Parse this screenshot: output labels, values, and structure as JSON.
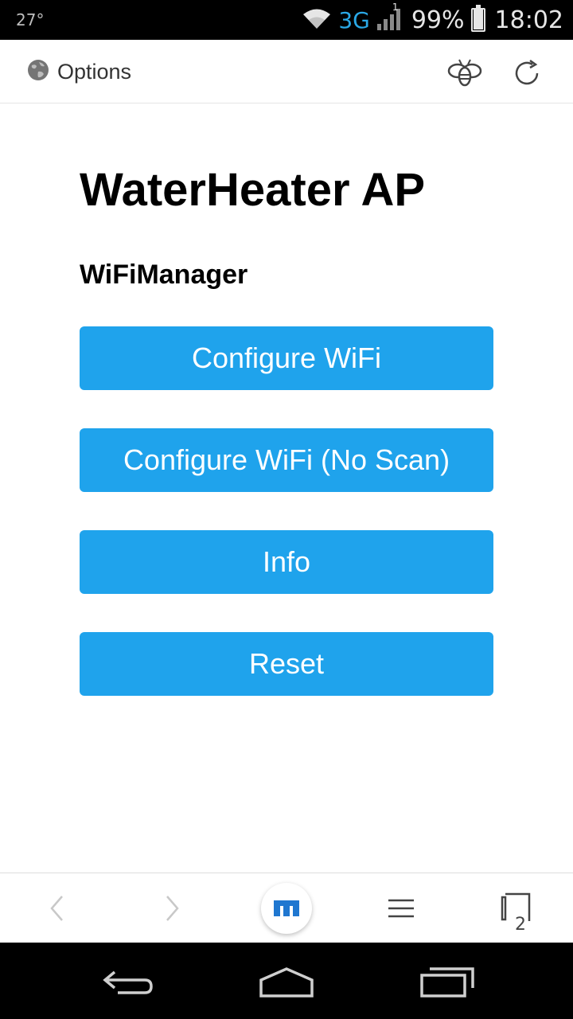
{
  "status_bar": {
    "temperature": "27°",
    "network_type": "3G",
    "signal_sim": "1",
    "battery_percent": "99%",
    "battery_level": 0.99,
    "time": "18:02"
  },
  "toolbar": {
    "options_label": "Options",
    "icons": [
      "globe-icon",
      "bee-icon",
      "refresh-icon"
    ]
  },
  "page": {
    "title": "WaterHeater AP",
    "subtitle": "WiFiManager",
    "buttons": [
      {
        "label": "Configure WiFi"
      },
      {
        "label": "Configure WiFi (No Scan)"
      },
      {
        "label": "Info"
      },
      {
        "label": "Reset"
      }
    ],
    "button_color": "#1fa3ec"
  },
  "bottom_nav": {
    "tab_count": "2",
    "icons": [
      "back-icon",
      "forward-icon",
      "home-icon",
      "menu-icon",
      "tabs-icon"
    ]
  },
  "system_nav": {
    "icons": [
      "back-icon",
      "home-icon",
      "recents-icon"
    ]
  }
}
